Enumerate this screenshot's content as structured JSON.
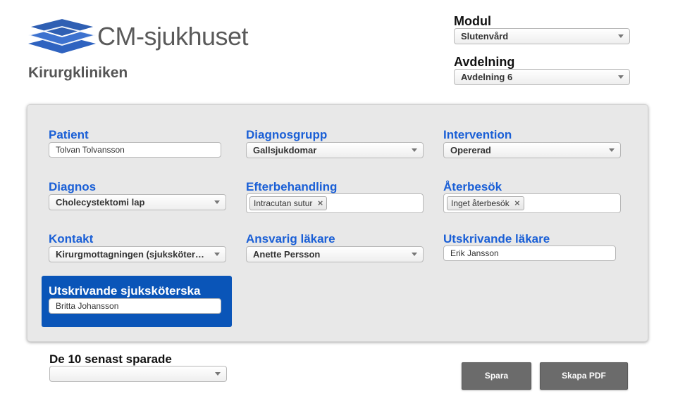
{
  "header": {
    "logo_text": "CM-sjukhuset",
    "clinic_title": "Kirurgkliniken"
  },
  "top_controls": {
    "modul_label": "Modul",
    "modul_value": "Slutenvård",
    "avdelning_label": "Avdelning",
    "avdelning_value": "Avdelning 6"
  },
  "form": {
    "patient": {
      "label": "Patient",
      "value": "Tolvan Tolvansson"
    },
    "diagnosgrupp": {
      "label": "Diagnosgrupp",
      "value": "Gallsjukdomar"
    },
    "intervention": {
      "label": "Intervention",
      "value": "Opererad"
    },
    "diagnos": {
      "label": "Diagnos",
      "value": "Cholecystektomi lap"
    },
    "efterbehandling": {
      "label": "Efterbehandling",
      "tags": [
        "Intracutan sutur"
      ]
    },
    "aterbesok": {
      "label": "Återbesök",
      "tags": [
        "Inget återbesök"
      ]
    },
    "kontakt": {
      "label": "Kontakt",
      "value": "Kirurgmottagningen (sjuksköter…"
    },
    "ansvarig_lakare": {
      "label": "Ansvarig läkare",
      "value": "Anette Persson"
    },
    "utskrivande_lakare": {
      "label": "Utskrivande läkare",
      "value": "Erik Jansson"
    },
    "utskrivande_sjukskoterska": {
      "label": "Utskrivande sjuksköterska",
      "value": "Britta Johansson"
    }
  },
  "recent": {
    "label": "De 10 senast sparade",
    "value": ""
  },
  "buttons": {
    "save": "Spara",
    "create_pdf": "Skapa PDF"
  },
  "colors": {
    "label_blue": "#1a5fd6",
    "highlight_blue": "#0a55b8",
    "button_gray": "#6b6b6b",
    "logo_blue": "#2f5fb3"
  }
}
